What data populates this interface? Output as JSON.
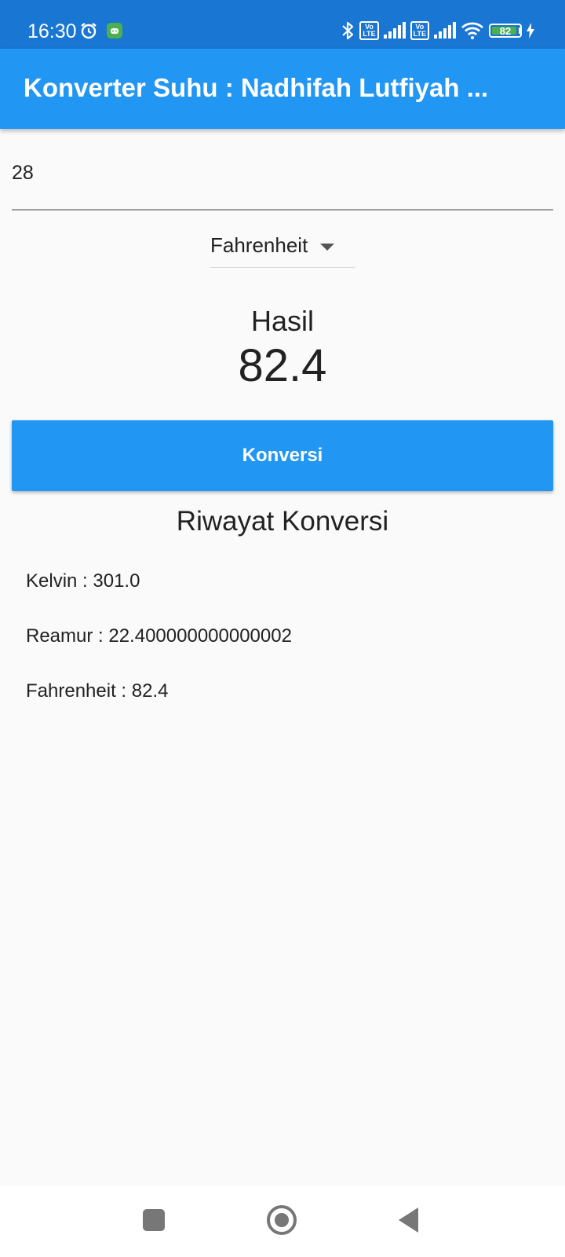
{
  "status_bar": {
    "time": "16:30",
    "battery_level": "82",
    "network_badges": [
      "Vo\nLTE",
      "Vo\nLTE"
    ],
    "background_color": "#1976d2",
    "icons": [
      "alarm-icon",
      "notification-app-icon",
      "bluetooth-icon",
      "volte-icon",
      "signal-icon",
      "wifi-icon",
      "battery-icon",
      "charging-icon"
    ]
  },
  "app_bar": {
    "title": "Konverter Suhu : Nadhifah Lutfiyah ...",
    "background_color": "#2196f3"
  },
  "input": {
    "value": "28",
    "placeholder": ""
  },
  "unit_dropdown": {
    "selected": "Fahrenheit",
    "icon": "caret-down-icon"
  },
  "result": {
    "label": "Hasil",
    "value": "82.4"
  },
  "convert_button": {
    "label": "Konversi",
    "color": "#2196f3"
  },
  "history": {
    "title": "Riwayat Konversi",
    "items": [
      "Kelvin : 301.0",
      "Reamur : 22.400000000000002",
      "Fahrenheit : 82.4"
    ]
  },
  "nav_bar": {
    "icons": [
      "recent-apps-icon",
      "home-icon",
      "back-icon"
    ]
  }
}
